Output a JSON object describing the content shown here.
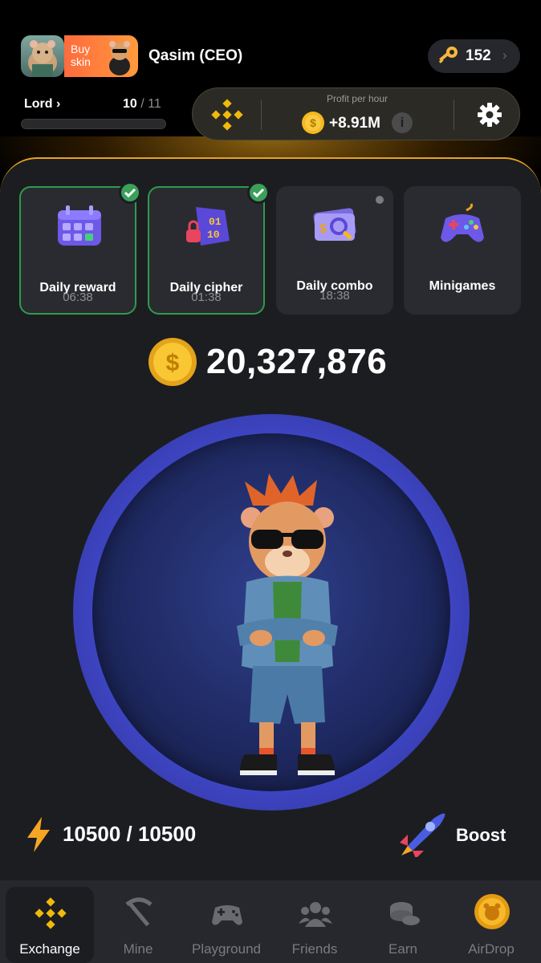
{
  "header": {
    "username": "Qasim (CEO)",
    "buy_skin_label": "Buy skin",
    "keys_count": "152",
    "level_name": "Lord",
    "level_current": "10",
    "level_total": "11",
    "level_progress": 0.0
  },
  "profit": {
    "label": "Profit per hour",
    "value": "+8.91M"
  },
  "cards": [
    {
      "title": "Daily reward",
      "time": "06:38",
      "completed": true
    },
    {
      "title": "Daily cipher",
      "time": "01:38",
      "completed": true
    },
    {
      "title": "Daily combo",
      "time": "18:38",
      "completed": false
    },
    {
      "title": "Minigames",
      "time": "",
      "completed": false
    }
  ],
  "balance": "20,327,876",
  "energy": "10500 / 10500",
  "boost_label": "Boost",
  "nav": [
    {
      "label": "Exchange",
      "icon": "binance-icon",
      "active": true
    },
    {
      "label": "Mine",
      "icon": "pickaxe-icon",
      "active": false
    },
    {
      "label": "Playground",
      "icon": "gamepad-icon",
      "active": false
    },
    {
      "label": "Friends",
      "icon": "friends-icon",
      "active": false
    },
    {
      "label": "Earn",
      "icon": "coins-icon",
      "active": false
    },
    {
      "label": "AirDrop",
      "icon": "hamster-coin-icon",
      "active": false
    }
  ],
  "colors": {
    "accent": "#e8a31f",
    "binance_yellow": "#f0b90b",
    "ring": "#3f46c6",
    "panel": "#1c1d21"
  }
}
